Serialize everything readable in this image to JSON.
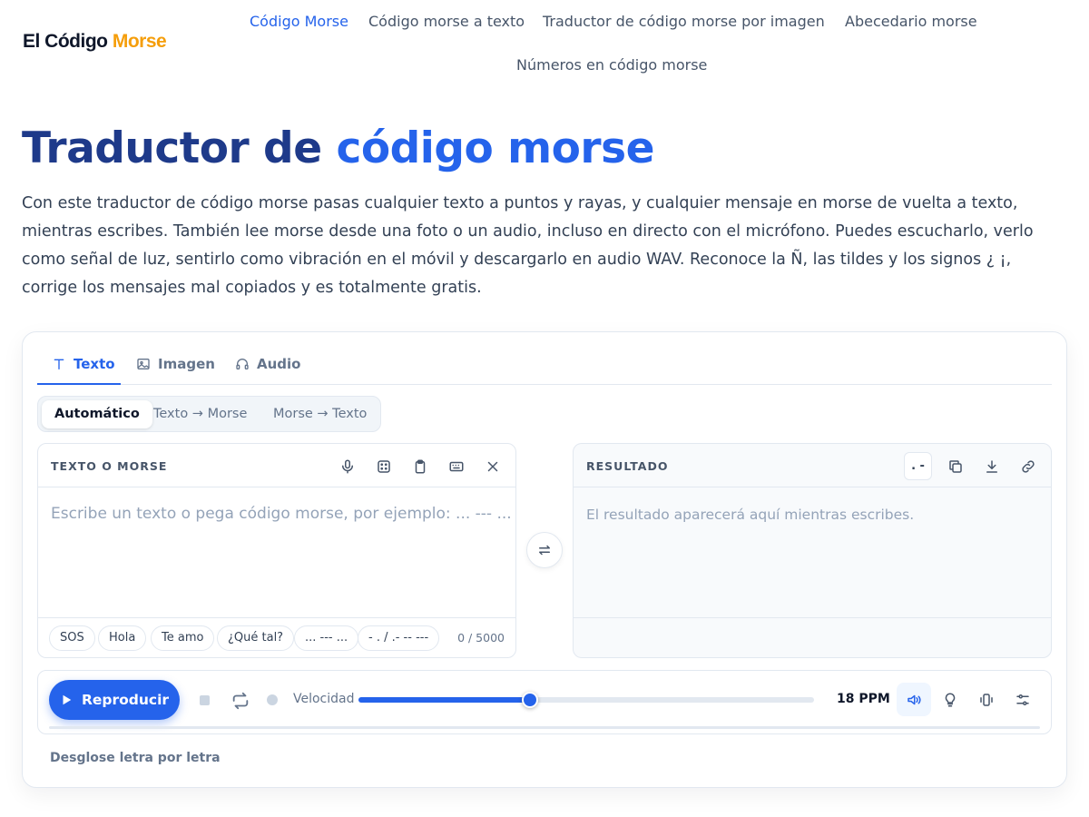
{
  "logo": {
    "part1": "El Código ",
    "part2": "Morse"
  },
  "nav": [
    {
      "label": "Código Morse",
      "active": true
    },
    {
      "label": "Código morse a texto"
    },
    {
      "label": "Traductor de código morse por imagen"
    },
    {
      "label": "Abecedario morse"
    },
    {
      "label": "Números en código morse"
    }
  ],
  "hero": {
    "title_part1": "Traductor de",
    "title_part2": "código morse",
    "intro": "Con este traductor de código morse pasas cualquier texto a puntos y rayas, y cualquier mensaje en morse de vuelta a texto, mientras escribes. También lee morse desde una foto o un audio, incluso en directo con el micrófono. Puedes escucharlo, verlo como señal de luz, sentirlo como vibración en el móvil y descargarlo en audio WAV. Reconoce la Ñ, las tildes y los signos ¿ ¡, corrige los mensajes mal copiados y es totalmente gratis."
  },
  "tabs": [
    {
      "label": "Texto",
      "icon": "text-icon",
      "active": true
    },
    {
      "label": "Imagen",
      "icon": "image-icon"
    },
    {
      "label": "Audio",
      "icon": "headphones-icon"
    }
  ],
  "modes": [
    {
      "label": "Automático",
      "active": true
    },
    {
      "label": "Texto → Morse"
    },
    {
      "label": "Morse → Texto"
    }
  ],
  "input_panel": {
    "label": "TEXTO O MORSE",
    "placeholder": "Escribe un texto o pega código morse, por ejemplo: ... --- ...",
    "chips": [
      "SOS",
      "Hola",
      "Te amo",
      "¿Qué tal?",
      "... --- ...",
      "- . / .- -- ---"
    ],
    "counter": "0 / 5000",
    "icons": [
      "microphone-icon",
      "dice-icon",
      "clipboard-icon",
      "keyboard-icon",
      "close-icon"
    ]
  },
  "output_panel": {
    "label": "RESULTADO",
    "placeholder": "El resultado aparecerá aquí mientras escribes.",
    "dotdash_label": ". -",
    "icons": [
      "copy-icon",
      "download-icon",
      "link-icon"
    ]
  },
  "player": {
    "play_label": "Reproducir",
    "speed_label": "Velocidad",
    "speed_value": "18 PPM",
    "speed_fraction": 0.376,
    "accent": "#2563eb"
  },
  "breakdown_label": "Desglose letra por letra"
}
